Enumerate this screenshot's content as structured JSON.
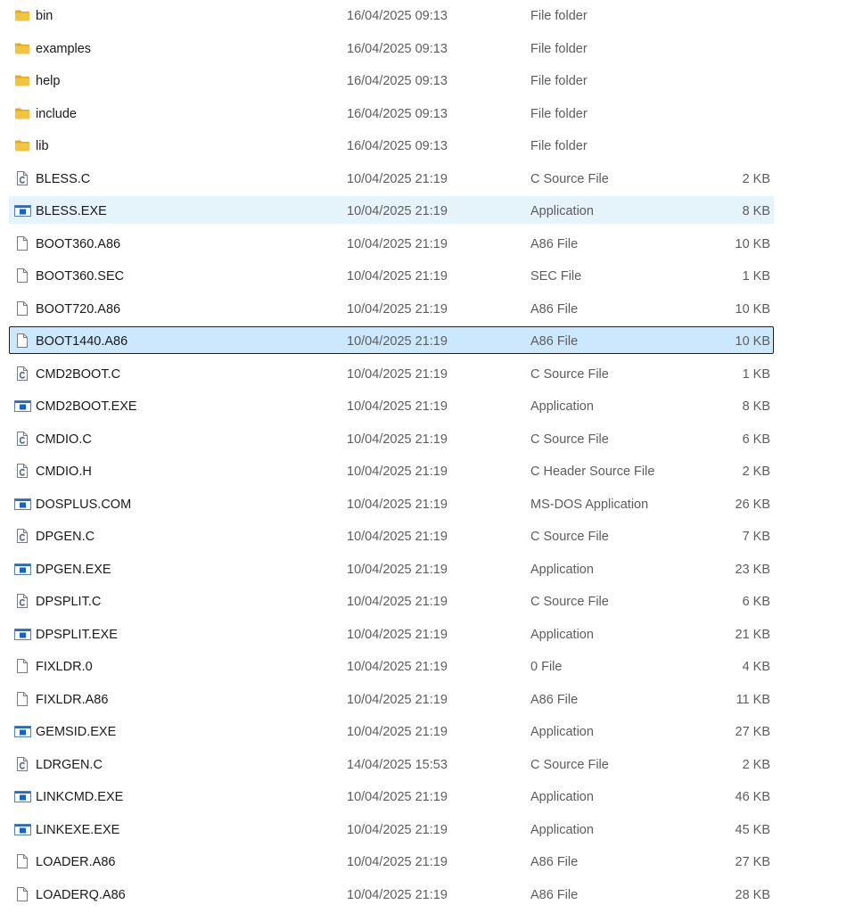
{
  "colors": {
    "folder": "#f3c343",
    "folder_tab": "#e3a81d",
    "app_blue": "#1565c0",
    "hover": "#e5f3fb",
    "selected": "#cce8ff",
    "c_icon": "#4a6a9a"
  },
  "files": [
    {
      "name": "bin",
      "date": "16/04/2025 09:13",
      "type": "File folder",
      "size": "",
      "icon": "folder-icon",
      "state": ""
    },
    {
      "name": "examples",
      "date": "16/04/2025 09:13",
      "type": "File folder",
      "size": "",
      "icon": "folder-icon",
      "state": ""
    },
    {
      "name": "help",
      "date": "16/04/2025 09:13",
      "type": "File folder",
      "size": "",
      "icon": "folder-icon",
      "state": ""
    },
    {
      "name": "include",
      "date": "16/04/2025 09:13",
      "type": "File folder",
      "size": "",
      "icon": "folder-icon",
      "state": ""
    },
    {
      "name": "lib",
      "date": "16/04/2025 09:13",
      "type": "File folder",
      "size": "",
      "icon": "folder-icon",
      "state": ""
    },
    {
      "name": "BLESS.C",
      "date": "10/04/2025 21:19",
      "type": "C Source File",
      "size": "2 KB",
      "icon": "c-source-icon",
      "state": ""
    },
    {
      "name": "BLESS.EXE",
      "date": "10/04/2025 21:19",
      "type": "Application",
      "size": "8 KB",
      "icon": "application-icon",
      "state": "hover"
    },
    {
      "name": "BOOT360.A86",
      "date": "10/04/2025 21:19",
      "type": "A86 File",
      "size": "10 KB",
      "icon": "file-icon",
      "state": ""
    },
    {
      "name": "BOOT360.SEC",
      "date": "10/04/2025 21:19",
      "type": "SEC File",
      "size": "1 KB",
      "icon": "file-icon",
      "state": ""
    },
    {
      "name": "BOOT720.A86",
      "date": "10/04/2025 21:19",
      "type": "A86 File",
      "size": "10 KB",
      "icon": "file-icon",
      "state": ""
    },
    {
      "name": "BOOT1440.A86",
      "date": "10/04/2025 21:19",
      "type": "A86 File",
      "size": "10 KB",
      "icon": "file-icon",
      "state": "selected"
    },
    {
      "name": "CMD2BOOT.C",
      "date": "10/04/2025 21:19",
      "type": "C Source File",
      "size": "1 KB",
      "icon": "c-source-icon",
      "state": ""
    },
    {
      "name": "CMD2BOOT.EXE",
      "date": "10/04/2025 21:19",
      "type": "Application",
      "size": "8 KB",
      "icon": "application-icon",
      "state": ""
    },
    {
      "name": "CMDIO.C",
      "date": "10/04/2025 21:19",
      "type": "C Source File",
      "size": "6 KB",
      "icon": "c-source-icon",
      "state": ""
    },
    {
      "name": "CMDIO.H",
      "date": "10/04/2025 21:19",
      "type": "C Header Source File",
      "size": "2 KB",
      "icon": "c-source-icon",
      "state": ""
    },
    {
      "name": "DOSPLUS.COM",
      "date": "10/04/2025 21:19",
      "type": "MS-DOS Application",
      "size": "26 KB",
      "icon": "application-icon",
      "state": ""
    },
    {
      "name": "DPGEN.C",
      "date": "10/04/2025 21:19",
      "type": "C Source File",
      "size": "7 KB",
      "icon": "c-source-icon",
      "state": ""
    },
    {
      "name": "DPGEN.EXE",
      "date": "10/04/2025 21:19",
      "type": "Application",
      "size": "23 KB",
      "icon": "application-icon",
      "state": ""
    },
    {
      "name": "DPSPLIT.C",
      "date": "10/04/2025 21:19",
      "type": "C Source File",
      "size": "6 KB",
      "icon": "c-source-icon",
      "state": ""
    },
    {
      "name": "DPSPLIT.EXE",
      "date": "10/04/2025 21:19",
      "type": "Application",
      "size": "21 KB",
      "icon": "application-icon",
      "state": ""
    },
    {
      "name": "FIXLDR.0",
      "date": "10/04/2025 21:19",
      "type": "0 File",
      "size": "4 KB",
      "icon": "file-icon",
      "state": ""
    },
    {
      "name": "FIXLDR.A86",
      "date": "10/04/2025 21:19",
      "type": "A86 File",
      "size": "11 KB",
      "icon": "file-icon",
      "state": ""
    },
    {
      "name": "GEMSID.EXE",
      "date": "10/04/2025 21:19",
      "type": "Application",
      "size": "27 KB",
      "icon": "application-icon",
      "state": ""
    },
    {
      "name": "LDRGEN.C",
      "date": "14/04/2025 15:53",
      "type": "C Source File",
      "size": "2 KB",
      "icon": "c-source-icon",
      "state": ""
    },
    {
      "name": "LINKCMD.EXE",
      "date": "10/04/2025 21:19",
      "type": "Application",
      "size": "46 KB",
      "icon": "application-icon",
      "state": ""
    },
    {
      "name": "LINKEXE.EXE",
      "date": "10/04/2025 21:19",
      "type": "Application",
      "size": "45 KB",
      "icon": "application-icon",
      "state": ""
    },
    {
      "name": "LOADER.A86",
      "date": "10/04/2025 21:19",
      "type": "A86 File",
      "size": "27 KB",
      "icon": "file-icon",
      "state": ""
    },
    {
      "name": "LOADERQ.A86",
      "date": "10/04/2025 21:19",
      "type": "A86 File",
      "size": "28 KB",
      "icon": "file-icon",
      "state": ""
    }
  ]
}
